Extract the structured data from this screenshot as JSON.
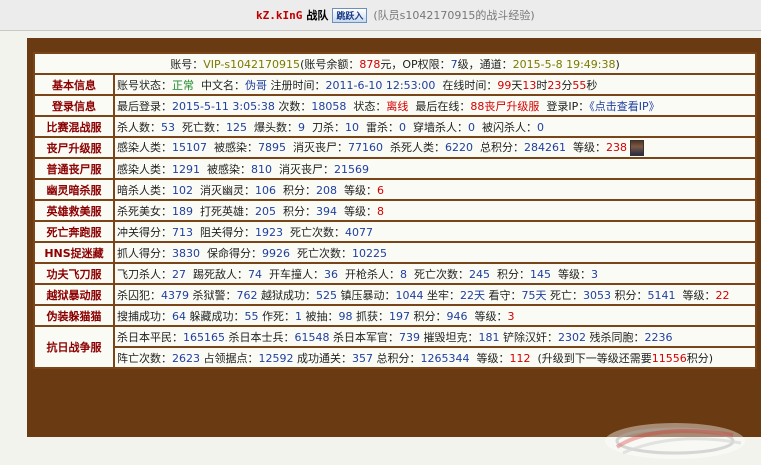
{
  "header": {
    "team_name": "kZ.kInG",
    "team_suffix": "战队",
    "join_label": "跳跃入",
    "member_text": "(队员s1042170915的战斗经验)"
  },
  "account": {
    "account_label": "账号：",
    "account_value": "VIP-s1042170915",
    "balance_label": "(账号余额：",
    "balance_value": "878",
    "balance_unit": "元，OP权限：",
    "op_value": "7",
    "op_unit": "级，通道：",
    "channel_value": "2015-5-8 19:49:38",
    "close_paren": ")"
  },
  "rows": [
    {
      "label": "基本信息",
      "segments": [
        {
          "text": "账号状态：",
          "cls": ""
        },
        {
          "text": "正常",
          "cls": "green"
        },
        {
          "text": "  中文名：",
          "cls": ""
        },
        {
          "text": "伪哥",
          "cls": "blue"
        },
        {
          "text": " 注册时间：",
          "cls": ""
        },
        {
          "text": "2011-6-10 12:53:00",
          "cls": "blue"
        },
        {
          "text": "  在线时间：",
          "cls": ""
        },
        {
          "text": "99",
          "cls": "red"
        },
        {
          "text": "天",
          "cls": ""
        },
        {
          "text": "13",
          "cls": "red"
        },
        {
          "text": "时",
          "cls": ""
        },
        {
          "text": "23",
          "cls": "red"
        },
        {
          "text": "分",
          "cls": ""
        },
        {
          "text": "55",
          "cls": "red"
        },
        {
          "text": "秒",
          "cls": ""
        }
      ]
    },
    {
      "label": "登录信息",
      "segments": [
        {
          "text": "最后登录：",
          "cls": ""
        },
        {
          "text": "2015-5-11 3:05:38",
          "cls": "blue"
        },
        {
          "text": " 次数：",
          "cls": ""
        },
        {
          "text": "18058",
          "cls": "blue"
        },
        {
          "text": "  状态：",
          "cls": ""
        },
        {
          "text": "离线",
          "cls": "red"
        },
        {
          "text": "  最后在线：",
          "cls": ""
        },
        {
          "text": "88丧尸升级服",
          "cls": "red"
        },
        {
          "text": "  登录IP：",
          "cls": ""
        },
        {
          "text": "《点击查看IP》",
          "cls": "link"
        }
      ]
    },
    {
      "label": "比赛混战服",
      "segments": [
        {
          "text": "杀人数：",
          "cls": ""
        },
        {
          "text": "53",
          "cls": "blue"
        },
        {
          "text": "  死亡数：",
          "cls": ""
        },
        {
          "text": "125",
          "cls": "blue"
        },
        {
          "text": "  爆头数：",
          "cls": ""
        },
        {
          "text": "9",
          "cls": "blue"
        },
        {
          "text": "  刀杀：",
          "cls": ""
        },
        {
          "text": "10",
          "cls": "blue"
        },
        {
          "text": "  雷杀：",
          "cls": ""
        },
        {
          "text": "0",
          "cls": "blue"
        },
        {
          "text": "  穿墙杀人：",
          "cls": ""
        },
        {
          "text": "0",
          "cls": "blue"
        },
        {
          "text": "  被闪杀人：",
          "cls": ""
        },
        {
          "text": "0",
          "cls": "blue"
        }
      ]
    },
    {
      "label": "丧尸升级服",
      "avatar": true,
      "segments": [
        {
          "text": "感染人类：",
          "cls": ""
        },
        {
          "text": "15107",
          "cls": "blue"
        },
        {
          "text": "  被感染：",
          "cls": ""
        },
        {
          "text": "7895",
          "cls": "blue"
        },
        {
          "text": "  消灭丧尸：",
          "cls": ""
        },
        {
          "text": "77160",
          "cls": "blue"
        },
        {
          "text": "  杀死人类：",
          "cls": ""
        },
        {
          "text": "6220",
          "cls": "blue"
        },
        {
          "text": "  总积分：",
          "cls": ""
        },
        {
          "text": "284261",
          "cls": "blue"
        },
        {
          "text": "  等级：",
          "cls": ""
        },
        {
          "text": "238",
          "cls": "red"
        }
      ]
    },
    {
      "label": "普通丧尸服",
      "segments": [
        {
          "text": "感染人类：",
          "cls": ""
        },
        {
          "text": "1291",
          "cls": "blue"
        },
        {
          "text": "  被感染：",
          "cls": ""
        },
        {
          "text": "810",
          "cls": "blue"
        },
        {
          "text": "  消灭丧尸：",
          "cls": ""
        },
        {
          "text": "21569",
          "cls": "blue"
        }
      ]
    },
    {
      "label": "幽灵暗杀服",
      "segments": [
        {
          "text": "暗杀人类：",
          "cls": ""
        },
        {
          "text": "102",
          "cls": "blue"
        },
        {
          "text": "  消灭幽灵：",
          "cls": ""
        },
        {
          "text": "106",
          "cls": "blue"
        },
        {
          "text": "  积分：",
          "cls": ""
        },
        {
          "text": "208",
          "cls": "blue"
        },
        {
          "text": "  等级：",
          "cls": ""
        },
        {
          "text": "6",
          "cls": "red"
        }
      ]
    },
    {
      "label": "英雄救美服",
      "segments": [
        {
          "text": "杀死美女：",
          "cls": ""
        },
        {
          "text": "189",
          "cls": "blue"
        },
        {
          "text": "  打死英雄：",
          "cls": ""
        },
        {
          "text": "205",
          "cls": "blue"
        },
        {
          "text": "  积分：",
          "cls": ""
        },
        {
          "text": "394",
          "cls": "blue"
        },
        {
          "text": "  等级：",
          "cls": ""
        },
        {
          "text": "8",
          "cls": "red"
        }
      ]
    },
    {
      "label": "死亡奔跑服",
      "segments": [
        {
          "text": "冲关得分：",
          "cls": ""
        },
        {
          "text": "713",
          "cls": "blue"
        },
        {
          "text": "  阻关得分：",
          "cls": ""
        },
        {
          "text": "1923",
          "cls": "blue"
        },
        {
          "text": "  死亡次数：",
          "cls": ""
        },
        {
          "text": "4077",
          "cls": "blue"
        }
      ]
    },
    {
      "label": "HNS捉迷藏",
      "segments": [
        {
          "text": "抓人得分：",
          "cls": ""
        },
        {
          "text": "3830",
          "cls": "blue"
        },
        {
          "text": "  保命得分：",
          "cls": ""
        },
        {
          "text": "9926",
          "cls": "blue"
        },
        {
          "text": "  死亡次数：",
          "cls": ""
        },
        {
          "text": "10225",
          "cls": "blue"
        }
      ]
    },
    {
      "label": "功夫飞刀服",
      "segments": [
        {
          "text": "飞刀杀人：",
          "cls": ""
        },
        {
          "text": "27",
          "cls": "blue"
        },
        {
          "text": "  踢死敌人：",
          "cls": ""
        },
        {
          "text": "74",
          "cls": "blue"
        },
        {
          "text": "  开车撞人：",
          "cls": ""
        },
        {
          "text": "36",
          "cls": "blue"
        },
        {
          "text": "  开枪杀人：",
          "cls": ""
        },
        {
          "text": "8",
          "cls": "blue"
        },
        {
          "text": "  死亡次数：",
          "cls": ""
        },
        {
          "text": "245",
          "cls": "blue"
        },
        {
          "text": "  积分：",
          "cls": ""
        },
        {
          "text": "145",
          "cls": "blue"
        },
        {
          "text": "  等级：",
          "cls": ""
        },
        {
          "text": "3",
          "cls": "blue"
        }
      ]
    },
    {
      "label": "越狱暴动服",
      "segments": [
        {
          "text": "杀囚犯：",
          "cls": ""
        },
        {
          "text": "4379",
          "cls": "blue"
        },
        {
          "text": " 杀狱警：",
          "cls": ""
        },
        {
          "text": "762",
          "cls": "blue"
        },
        {
          "text": " 越狱成功：",
          "cls": ""
        },
        {
          "text": "525",
          "cls": "blue"
        },
        {
          "text": " 镇压暴动：",
          "cls": ""
        },
        {
          "text": "1044",
          "cls": "blue"
        },
        {
          "text": " 坐牢：",
          "cls": ""
        },
        {
          "text": "22天",
          "cls": "blue"
        },
        {
          "text": " 看守：",
          "cls": ""
        },
        {
          "text": "75天",
          "cls": "blue"
        },
        {
          "text": " 死亡：",
          "cls": ""
        },
        {
          "text": "3053",
          "cls": "blue"
        },
        {
          "text": " 积分：",
          "cls": ""
        },
        {
          "text": "5141",
          "cls": "blue"
        },
        {
          "text": "  等级：",
          "cls": ""
        },
        {
          "text": "22",
          "cls": "red"
        }
      ]
    },
    {
      "label": "伪装躲猫猫",
      "segments": [
        {
          "text": "搜捕成功：",
          "cls": ""
        },
        {
          "text": "64",
          "cls": "blue"
        },
        {
          "text": " 躲藏成功：",
          "cls": ""
        },
        {
          "text": "55",
          "cls": "blue"
        },
        {
          "text": " 作死：",
          "cls": ""
        },
        {
          "text": "1",
          "cls": "blue"
        },
        {
          "text": " 被抽：",
          "cls": ""
        },
        {
          "text": "98",
          "cls": "blue"
        },
        {
          "text": " 抓获：",
          "cls": ""
        },
        {
          "text": "197",
          "cls": "blue"
        },
        {
          "text": " 积分：",
          "cls": ""
        },
        {
          "text": "946",
          "cls": "blue"
        },
        {
          "text": "  等级：",
          "cls": ""
        },
        {
          "text": "3",
          "cls": "red"
        }
      ]
    },
    {
      "label": "抗日战争服",
      "double": true,
      "segments": [
        {
          "text": "杀日本平民：",
          "cls": ""
        },
        {
          "text": "165165",
          "cls": "blue"
        },
        {
          "text": " 杀日本士兵：",
          "cls": ""
        },
        {
          "text": "61548",
          "cls": "blue"
        },
        {
          "text": " 杀日本军官：",
          "cls": ""
        },
        {
          "text": "739",
          "cls": "blue"
        },
        {
          "text": " 摧毁坦克：",
          "cls": ""
        },
        {
          "text": "181",
          "cls": "blue"
        },
        {
          "text": " 铲除汉奸：",
          "cls": ""
        },
        {
          "text": "2302",
          "cls": "blue"
        },
        {
          "text": " 残杀同胞：",
          "cls": ""
        },
        {
          "text": "2236",
          "cls": "blue"
        }
      ],
      "segments2": [
        {
          "text": "阵亡次数：",
          "cls": ""
        },
        {
          "text": "2623",
          "cls": "blue"
        },
        {
          "text": " 占领据点：",
          "cls": ""
        },
        {
          "text": "12592",
          "cls": "blue"
        },
        {
          "text": " 成功通关：",
          "cls": ""
        },
        {
          "text": "357",
          "cls": "blue"
        },
        {
          "text": " 总积分：",
          "cls": ""
        },
        {
          "text": "1265344",
          "cls": "blue"
        },
        {
          "text": "  等级：",
          "cls": ""
        },
        {
          "text": "112",
          "cls": "red"
        },
        {
          "text": "  (升级到下一等级还需要",
          "cls": ""
        },
        {
          "text": "11556",
          "cls": "red"
        },
        {
          "text": "积分)",
          "cls": ""
        }
      ]
    }
  ]
}
